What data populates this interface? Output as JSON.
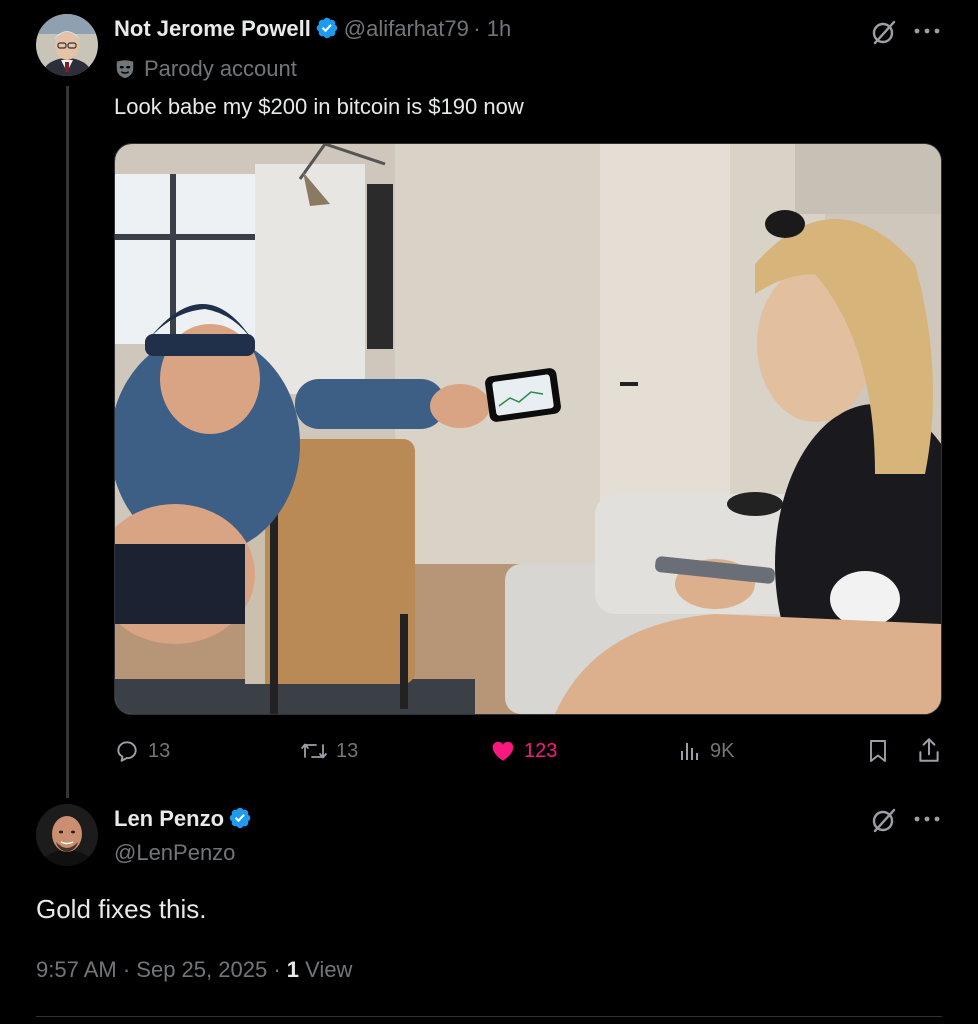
{
  "tweet": {
    "author_name": "Not Jerome Powell",
    "handle": "@alifarhat79",
    "time": "· 1h",
    "parody_label": "Parody account",
    "text": "Look babe my $200 in bitcoin is $190 now",
    "image_alt": "Man on chair holding phone showing chart to woman on couch",
    "actions": {
      "replies": "13",
      "reposts": "13",
      "likes": "123",
      "views": "9K"
    }
  },
  "reply": {
    "author_name": "Len Penzo",
    "handle": "@LenPenzo",
    "text": "Gold fixes this.",
    "time": "9:57 AM",
    "date": "Sep 25, 2025",
    "views_count": "1",
    "views_label": "View"
  },
  "icons": {
    "verified": "verified-badge-icon",
    "grok": "grok-icon",
    "more": "more-icon",
    "reply": "reply-icon",
    "repost": "repost-icon",
    "like": "heart-icon",
    "views": "analytics-icon",
    "bookmark": "bookmark-icon",
    "share": "share-icon",
    "parody": "mask-icon"
  },
  "colors": {
    "background": "#000000",
    "text": "#e7e9ea",
    "muted": "#71767b",
    "verified": "#1d9bf0",
    "like": "#f91880"
  }
}
